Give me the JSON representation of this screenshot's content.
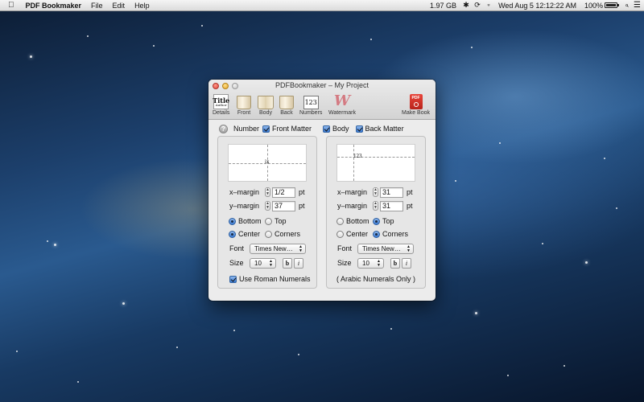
{
  "menubar": {
    "app_name": "PDF Bookmaker",
    "menus": [
      "File",
      "Edit",
      "Help"
    ],
    "memory": "1.97 GB",
    "clock": "Wed Aug 5  12:12:22 AM",
    "battery": "100%",
    "battery_level": 1.0
  },
  "window": {
    "title": "PDFBookmaker – My Project",
    "toolbar": {
      "details": "Details",
      "details_icon_title": "Title",
      "details_icon_author": "Author",
      "front": "Front",
      "body": "Body",
      "back": "Back",
      "numbers": "Numbers",
      "numbers_icon": "123",
      "watermark": "Watermark",
      "watermark_icon": "W",
      "make_book": "Make Book",
      "make_book_icon": "PDF"
    },
    "options": {
      "help": "?",
      "number_label": "Number",
      "front_matter": "Front Matter",
      "front_matter_checked": true,
      "body": "Body",
      "body_checked": true,
      "back_matter": "Back Matter",
      "back_matter_checked": true
    },
    "front_panel": {
      "preview_number": "ix",
      "x_margin_label": "x–margin",
      "x_margin": "1/2",
      "y_margin_label": "y–margin",
      "y_margin": "37",
      "unit": "pt",
      "vertical_options": [
        "Bottom",
        "Top"
      ],
      "vertical_selected": "Bottom",
      "horizontal_options": [
        "Center",
        "Corners"
      ],
      "horizontal_selected": "Center",
      "font_label": "Font",
      "font": "Times New…",
      "size_label": "Size",
      "size": "10",
      "bold": "b",
      "italic": "i",
      "roman_label": "Use Roman Numerals",
      "roman_checked": true
    },
    "back_panel": {
      "preview_number": "123",
      "x_margin_label": "x–margin",
      "x_margin": "31",
      "y_margin_label": "y–margin",
      "y_margin": "31",
      "unit": "pt",
      "vertical_options": [
        "Bottom",
        "Top"
      ],
      "vertical_selected": "Top",
      "horizontal_options": [
        "Center",
        "Corners"
      ],
      "horizontal_selected": "Corners",
      "font_label": "Font",
      "font": "Times New…",
      "size_label": "Size",
      "size": "10",
      "bold": "b",
      "italic": "i",
      "note": "( Arabic Numerals Only )"
    }
  }
}
